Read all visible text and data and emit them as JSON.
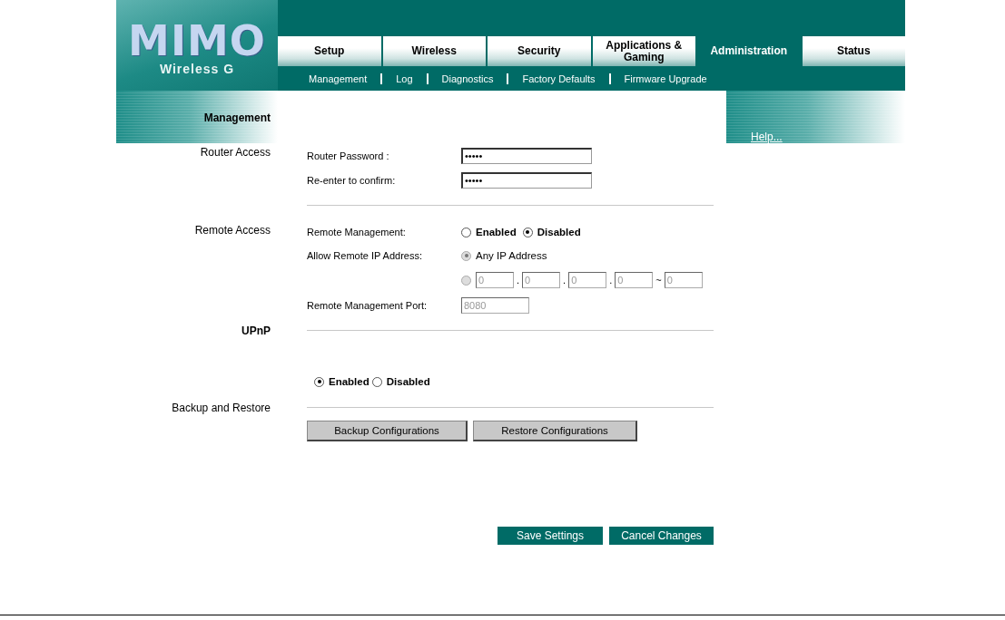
{
  "logo": {
    "title": "MIMO",
    "subtitle": "Wireless G"
  },
  "tabs": [
    {
      "label": "Setup",
      "selected": false
    },
    {
      "label": "Wireless",
      "selected": false
    },
    {
      "label": "Security",
      "selected": false
    },
    {
      "label": "Applications & Gaming",
      "selected": false
    },
    {
      "label": "Administration",
      "selected": true
    },
    {
      "label": "Status",
      "selected": false
    }
  ],
  "subtabs": [
    "Management",
    "Log",
    "Diagnostics",
    "Factory Defaults",
    "Firmware Upgrade"
  ],
  "router_access": {
    "heading": "Management",
    "label": "Router Access",
    "fields": [
      {
        "label": "Router Password :",
        "value": "•••••"
      },
      {
        "label": "Re-enter to confirm:",
        "value": "•••••"
      }
    ]
  },
  "remote_access": {
    "label": "Remote Access",
    "management_label": "Remote Management:",
    "management_options": [
      {
        "label": "Enabled",
        "selected": false
      },
      {
        "label": "Disabled",
        "selected": true
      }
    ],
    "allow_label": "Allow Remote IP Address:",
    "allow_options": [
      {
        "kind": "any",
        "label": "Any IP Address",
        "selected": true,
        "disabled": true
      },
      {
        "kind": "range",
        "selected": false,
        "disabled": true,
        "fields": [
          {
            "value": "0",
            "separator": "."
          },
          {
            "value": "0",
            "separator": "."
          },
          {
            "value": "0",
            "separator": "."
          },
          {
            "value": "0",
            "separator": "~"
          },
          {
            "value": "0"
          }
        ]
      }
    ],
    "port_label": "Remote Management Port:",
    "port": "8080",
    "port_disabled": true
  },
  "upnp": {
    "heading": "UPnP",
    "options": [
      {
        "label": "Enabled",
        "selected": true
      },
      {
        "label": "Disabled",
        "selected": false
      }
    ]
  },
  "backup": {
    "label": "Backup and Restore",
    "buttons": [
      "Backup Configurations",
      "Restore Configurations"
    ]
  },
  "actions": [
    "Save Settings",
    "Cancel Changes"
  ],
  "help": "Help..."
}
